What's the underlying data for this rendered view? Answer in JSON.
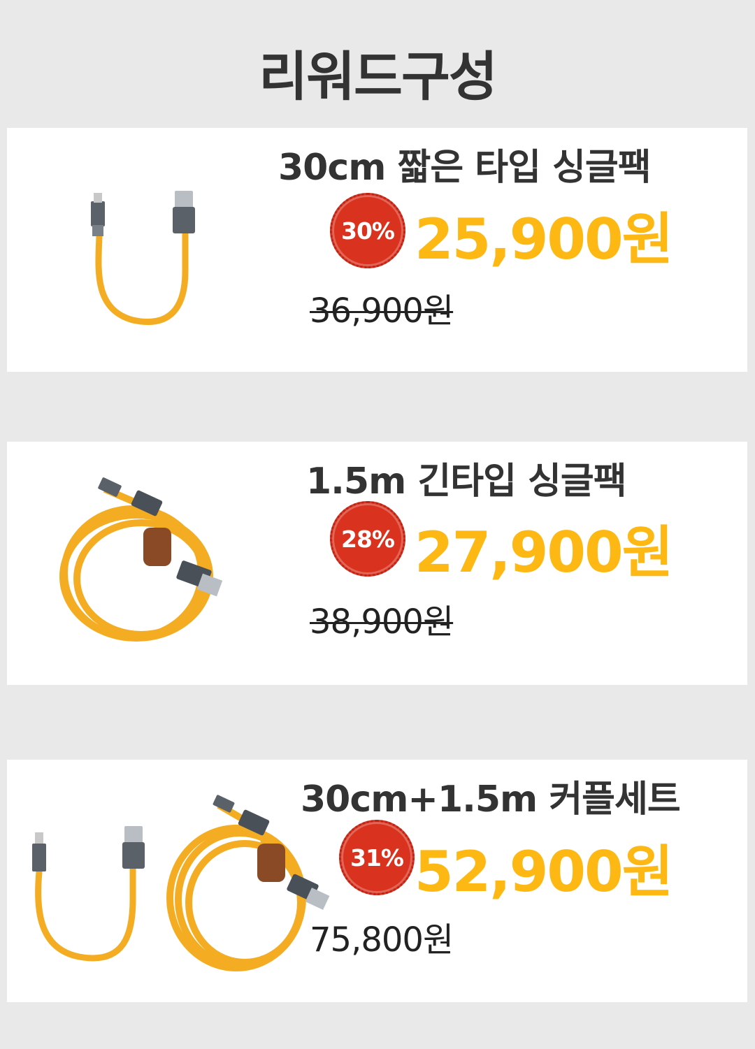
{
  "title": "리워드구성",
  "products": [
    {
      "name": "30cm 짧은 타입 싱글팩",
      "discount": "30%",
      "price": "25,900원",
      "original_price": "36,900원"
    },
    {
      "name": "1.5m 긴타입 싱글팩",
      "discount": "28%",
      "price": "27,900원",
      "original_price": "38,900원"
    },
    {
      "name": "30cm+1.5m 커플세트",
      "discount": "31%",
      "price": "52,900원",
      "original_price": "75,800원"
    }
  ],
  "colors": {
    "background": "#e9e9e9",
    "card": "#ffffff",
    "badge": "#d9321e",
    "price": "#fdb813",
    "cable": "#f5b226"
  },
  "icons": [
    "short-cable-image",
    "long-cable-image"
  ]
}
